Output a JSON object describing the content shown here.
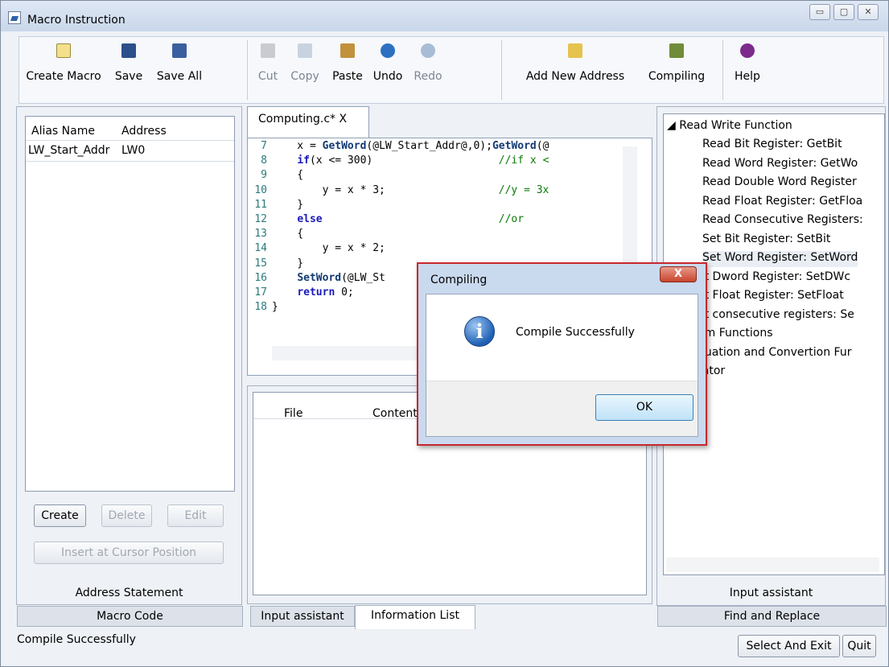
{
  "window": {
    "title": "Macro Instruction"
  },
  "window_controls": {
    "minimize": "▭",
    "maximize": "▢",
    "close": "✕"
  },
  "toolbar": {
    "create_macro": "Create Macro",
    "save": "Save",
    "save_all": "Save All",
    "cut": "Cut",
    "copy": "Copy",
    "paste": "Paste",
    "undo": "Undo",
    "redo": "Redo",
    "add_new_address": "Add New Address",
    "compiling": "Compiling",
    "help": "Help"
  },
  "address_panel": {
    "headers": [
      "Alias Name",
      "Address"
    ],
    "rows": [
      [
        "LW_Start_Addr",
        "LW0"
      ]
    ],
    "create": "Create",
    "delete": "Delete",
    "edit": "Edit",
    "insert": "Insert at Cursor Position",
    "label": "Address Statement"
  },
  "editor": {
    "tab": "Computing.c* X",
    "lines": [
      {
        "n": "7",
        "text": "    x = GetWord(@LW_Start_Addr@,0);GetWord(@"
      },
      {
        "n": "8",
        "text": "    if(x <= 300)                    //if x <"
      },
      {
        "n": "9",
        "text": "    {"
      },
      {
        "n": "10",
        "text": "        y = x * 3;                  //y = 3x"
      },
      {
        "n": "11",
        "text": "    }"
      },
      {
        "n": "12",
        "text": "    else                            //or"
      },
      {
        "n": "13",
        "text": "    {"
      },
      {
        "n": "14",
        "text": "        y = x * 2;"
      },
      {
        "n": "15",
        "text": "    }"
      },
      {
        "n": "16",
        "text": "    SetWord(@LW_St"
      },
      {
        "n": "17",
        "text": "    return 0;"
      },
      {
        "n": "18",
        "text": "}"
      }
    ]
  },
  "info_list": {
    "headers": [
      "File",
      "Content"
    ]
  },
  "right_panel": {
    "root": "Read Write Function",
    "items": [
      "Read Bit Register: GetBit",
      "Read Word Register: GetWo",
      "Read Double Word Register",
      "Read Float Register: GetFloa",
      "Read Consecutive Registers:",
      "Set Bit Register: SetBit",
      "Set Word Register: SetWord",
      "et Dword Register: SetDWc",
      "et Float Register: SetFloat",
      "et consecutive registers: Se",
      "em Functions",
      "puation and Convertion Fur",
      "rator"
    ],
    "label": "Input assistant"
  },
  "bottom_tabs": {
    "macro_code": "Macro Code",
    "input_assistant": "Input assistant",
    "information_list": "Information List",
    "find_replace": "Find and Replace"
  },
  "status": "Compile Successfully",
  "footer_buttons": {
    "select_exit": "Select And Exit",
    "quit": "Quit"
  },
  "dialog": {
    "title": "Compiling",
    "close_glyph": "X",
    "icon_glyph": "i",
    "message": "Compile Successfully",
    "ok": "OK"
  }
}
